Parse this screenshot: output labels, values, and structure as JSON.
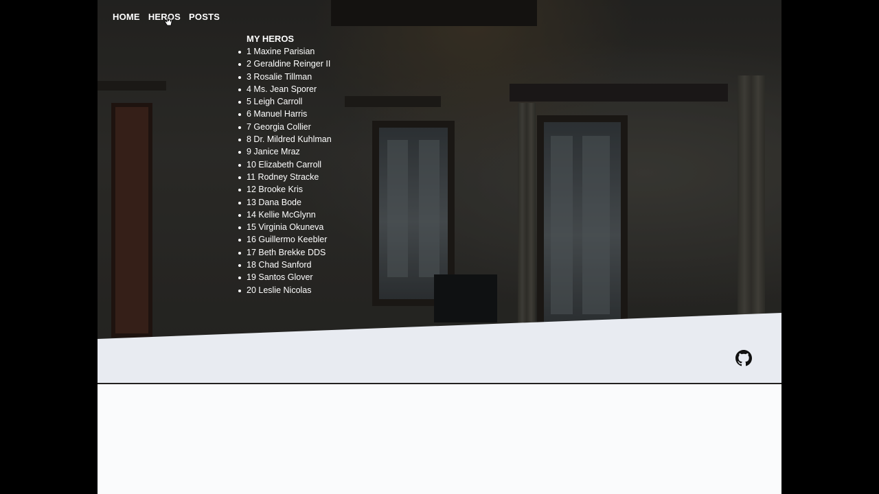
{
  "nav": {
    "items": [
      "HOME",
      "HEROS",
      "POSTS"
    ]
  },
  "heroes": {
    "title": "MY HEROS",
    "items": [
      "1 Maxine Parisian",
      "2 Geraldine Reinger II",
      "3 Rosalie Tillman",
      "4 Ms. Jean Sporer",
      "5 Leigh Carroll",
      "6 Manuel Harris",
      "7 Georgia Collier",
      "8 Dr. Mildred Kuhlman",
      "9 Janice Mraz",
      "10 Elizabeth Carroll",
      "11 Rodney Stracke",
      "12 Brooke Kris",
      "13 Dana Bode",
      "14 Kellie McGlynn",
      "15 Virginia Okuneva",
      "16 Guillermo Keebler",
      "17 Beth Brekke DDS",
      "18 Chad Sanford",
      "19 Santos Glover",
      "20 Leslie Nicolas"
    ]
  },
  "footer": {
    "icon": "github-icon"
  },
  "colors": {
    "text": "#ffffff",
    "band": "#e8ebf1",
    "page": "#fafbfc",
    "outside": "#000000"
  }
}
